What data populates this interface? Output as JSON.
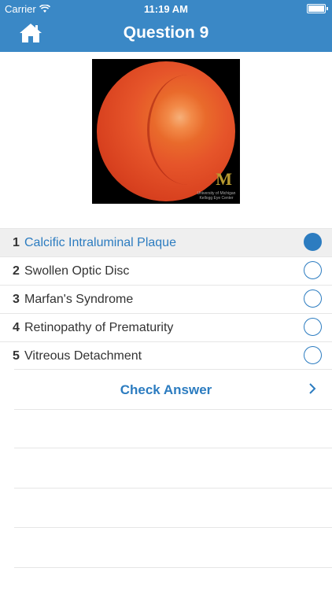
{
  "status": {
    "carrier": "Carrier",
    "time": "11:19 AM"
  },
  "header": {
    "title": "Question 9",
    "home_icon": "home-icon",
    "color": "#3a88c6"
  },
  "image": {
    "logo_letter": "M",
    "logo_text": "University of Michigan Kellogg Eye Center"
  },
  "options": [
    {
      "num": "1",
      "label": "Calcific Intraluminal Plaque",
      "selected": true
    },
    {
      "num": "2",
      "label": "Swollen Optic Disc",
      "selected": false
    },
    {
      "num": "3",
      "label": "Marfan's Syndrome",
      "selected": false
    },
    {
      "num": "4",
      "label": "Retinopathy of Prematurity",
      "selected": false
    },
    {
      "num": "5",
      "label": "Vitreous Detachment",
      "selected": false
    }
  ],
  "check_answer": {
    "label": "Check Answer",
    "icon": "chevron-right-icon"
  },
  "accent_color": "#2c7cc0"
}
